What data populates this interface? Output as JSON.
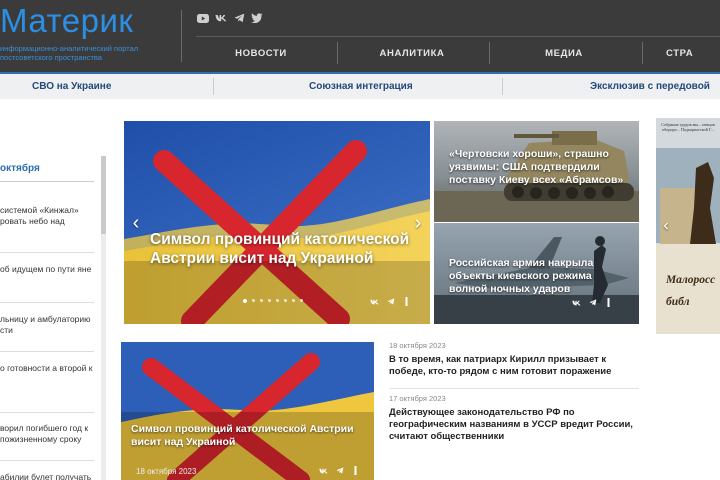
{
  "site": {
    "title": "Материк",
    "tagline": "информационно-аналитический портал постсоветского пространства"
  },
  "social_icons": [
    "youtube-icon",
    "vk-icon",
    "telegram-icon",
    "twitter-icon"
  ],
  "nav": {
    "items": [
      {
        "label": "НОВОСТИ"
      },
      {
        "label": "АНАЛИТИКА"
      },
      {
        "label": "МЕДИА"
      },
      {
        "label": "СТРА"
      }
    ]
  },
  "subnav": {
    "items": [
      {
        "label": "СВО на Украине"
      },
      {
        "label": "Союзная интеграция"
      },
      {
        "label": "Эксклюзив с передовой"
      }
    ]
  },
  "sidebar": {
    "date": "октября",
    "items": [
      {
        "text": "системой «Кинжал» ровать небо над"
      },
      {
        "text": "об идущем по пути яне"
      },
      {
        "text": "льницу и амбулаторию сти"
      },
      {
        "text": "о готовности а второй к"
      },
      {
        "text": "ворил погибшего год к пожизненному сроку"
      },
      {
        "text": "абилии булет получать"
      }
    ]
  },
  "hero": {
    "title": "Символ провинций католической Австрии висит над Украиной",
    "prev_icon": "chevron-left-icon",
    "next_icon": "chevron-right-icon",
    "slide_count": 8,
    "active_slide": 1
  },
  "cards": [
    {
      "title": "«Чертовски хороши», страшно уязвимы: США подтвердили поставку Киеву всех «Абрамсов»"
    },
    {
      "title": "Российская армия накрыла объекты киевского режима волной ночных ударов"
    }
  ],
  "banner": {
    "text": "Собрание трудов мы... певцов обороро... Подкарпатской Г...",
    "big_text": "Малоросс библ"
  },
  "feature": {
    "title": "Символ провинций католической Австрии висит над Украиной",
    "date": "18 октября 2023"
  },
  "text_news": [
    {
      "date": "18 октября 2023",
      "title": "В то время, как патриарх Кирилл призывает к победе, кто-то рядом с ним готовит поражение"
    },
    {
      "date": "17 октября 2023",
      "title": "Действующее законодательство РФ по географическим названиям в УССР вредит России, считают общественники"
    }
  ],
  "colors": {
    "header_bg": "#3b3b3b",
    "logo_blue": "#2b8fe6",
    "accent_blue": "#2d6fb4",
    "subbar_bg": "#eff0f2",
    "flag_blue": "#2d5fb8",
    "flag_yellow": "#f0c93a",
    "cross_red": "#d8262e"
  }
}
